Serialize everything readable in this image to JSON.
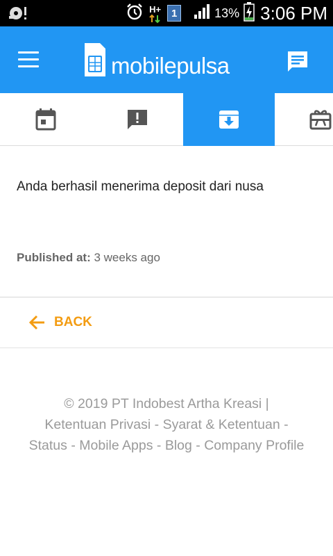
{
  "status_bar": {
    "battery_percent": "13%",
    "time": "3:06 PM",
    "network_type": "H+",
    "sim_number": "1",
    "icons": [
      "app-notification-icon",
      "alarm-icon",
      "data-hplus-icon",
      "sim-icon",
      "signal-icon",
      "battery-charging-icon"
    ]
  },
  "app_bar": {
    "logo_text": "mobilepulsa",
    "brand_color": "#2196f3",
    "icons": [
      "menu-icon",
      "sim-card-logo-icon",
      "chat-icon"
    ]
  },
  "tabs": [
    {
      "icon": "calendar-icon",
      "active": false
    },
    {
      "icon": "alert-message-icon",
      "active": false
    },
    {
      "icon": "inbox-download-icon",
      "active": true
    },
    {
      "icon": "card-giftcard-icon",
      "active": false
    }
  ],
  "notification": {
    "message": "Anda berhasil menerima deposit dari nusa",
    "published_label": "Published at:",
    "published_value": "3 weeks ago"
  },
  "back": {
    "label": "BACK",
    "icon": "arrow-left-icon",
    "color": "#f39c12"
  },
  "footer": {
    "copyright": "© 2019 PT Indobest Artha Kreasi |",
    "links": {
      "privacy": "Ketentuan Privasi",
      "terms": "Syarat & Ketentuan",
      "status": "Status",
      "mobile_apps": "Mobile Apps",
      "blog": "Blog",
      "company_profile": "Company Profile"
    },
    "separator": " - "
  }
}
